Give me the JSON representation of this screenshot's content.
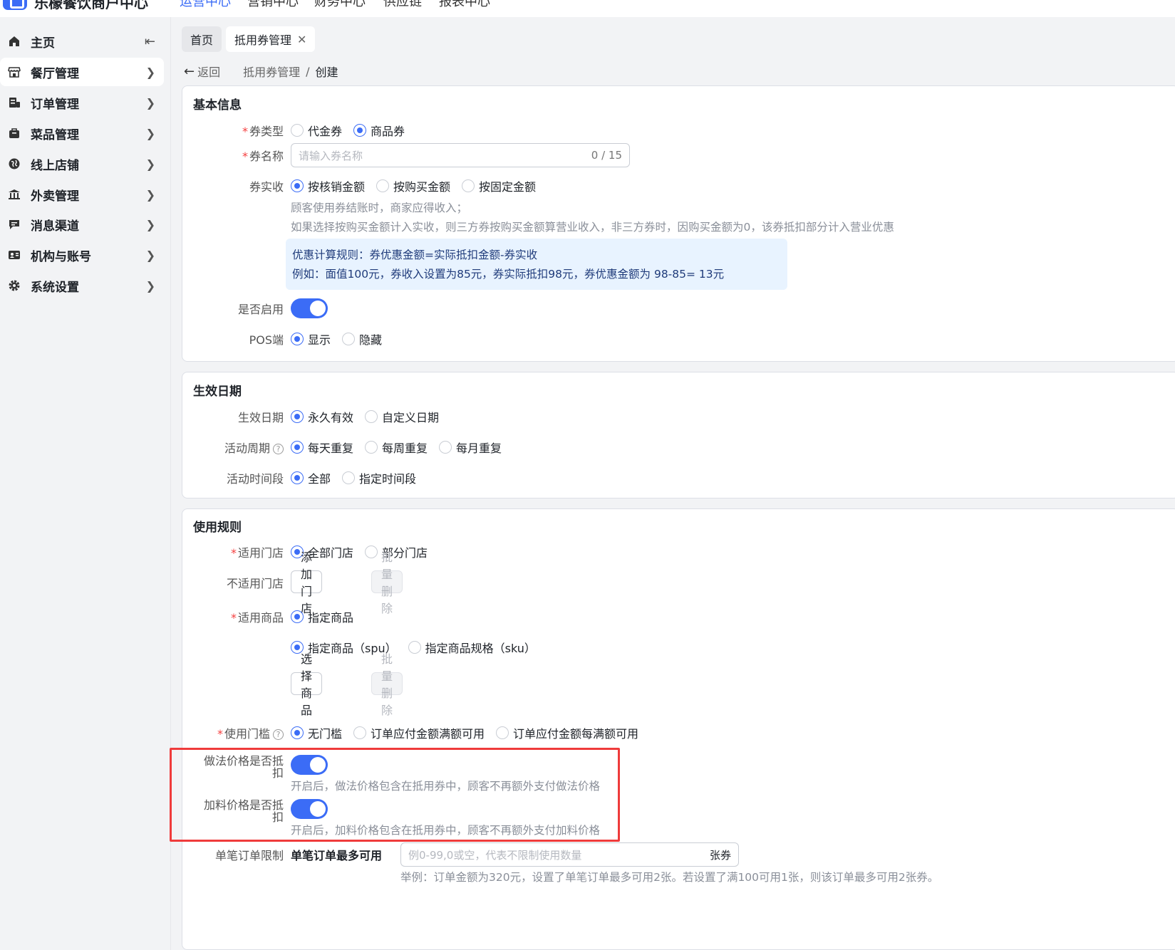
{
  "topnav": {
    "app_title": "乐檬餐饮商户中心",
    "items": [
      "运营中心",
      "营销中心",
      "财务中心",
      "供应链",
      "报表中心"
    ]
  },
  "sidebar": {
    "collapse_icon": "collapse-left-icon",
    "items": [
      {
        "label": "主页",
        "icon": "home-icon"
      },
      {
        "label": "餐厅管理",
        "icon": "store-icon"
      },
      {
        "label": "订单管理",
        "icon": "order-icon"
      },
      {
        "label": "菜品管理",
        "icon": "dish-icon"
      },
      {
        "label": "线上店铺",
        "icon": "globe-icon"
      },
      {
        "label": "外卖管理",
        "icon": "bank-icon"
      },
      {
        "label": "消息渠道",
        "icon": "message-icon"
      },
      {
        "label": "机构与账号",
        "icon": "account-icon"
      },
      {
        "label": "系统设置",
        "icon": "gear-icon"
      }
    ]
  },
  "tabs": [
    {
      "label": "首页"
    },
    {
      "label": "抵用券管理"
    }
  ],
  "back_label": "返回",
  "breadcrumb": {
    "parent": "抵用券管理",
    "sep": "/",
    "current": "创建"
  },
  "basic": {
    "title": "基本信息",
    "type_label": "券类型",
    "type_options": [
      "代金券",
      "商品券"
    ],
    "name_label": "券名称",
    "name_placeholder": "请输入券名称",
    "name_counter": "0 / 15",
    "income_label": "券实收",
    "income_options": [
      "按核销金额",
      "按购买金额",
      "按固定金额"
    ],
    "income_hint1": "顾客使用券结账时，商家应得收入；",
    "income_hint2": "如果选择按购买金额计入实收，则三方券按购买金额算营业收入，非三方券时，因购买金额为0，该券抵扣部分计入营业优惠",
    "info_line1": "优惠计算规则：券优惠金额=实际抵扣金额-券实收",
    "info_line2": "例如：面值100元，券收入设置为85元，券实际抵扣98元，券优惠金额为 98-85= 13元",
    "enable_label": "是否启用",
    "pos_label": "POS端",
    "pos_options": [
      "显示",
      "隐藏"
    ]
  },
  "validity": {
    "title": "生效日期",
    "date_label": "生效日期",
    "date_options": [
      "永久有效",
      "自定义日期"
    ],
    "cycle_label": "活动周期",
    "cycle_options": [
      "每天重复",
      "每周重复",
      "每月重复"
    ],
    "period_label": "活动时间段",
    "period_options": [
      "全部",
      "指定时间段"
    ]
  },
  "rules": {
    "title": "使用规则",
    "store_label": "适用门店",
    "store_options": [
      "全部门店",
      "部分门店"
    ],
    "exclude_label": "不适用门店",
    "add_store_btn": "添加门店",
    "batch_delete_btn": "批量删除",
    "goods_label": "适用商品",
    "goods_option": "指定商品",
    "goods_sub_options": [
      "指定商品（spu）",
      "指定商品规格（sku）"
    ],
    "select_goods_btn": "选择商品",
    "threshold_label": "使用门槛",
    "threshold_options": [
      "无门槛",
      "订单应付金额满额可用",
      "订单应付金额每满额可用"
    ],
    "method_label_1": "做法价格是否抵",
    "method_label_2": "扣",
    "method_hint": "开启后，做法价格包含在抵用券中，顾客不再额外支付做法价格",
    "addon_label_1": "加料价格是否抵",
    "addon_label_2": "扣",
    "addon_hint": "开启后，加料价格包含在抵用券中，顾客不再额外支付加料价格",
    "limit_label": "单笔订单限制",
    "limit_prefix": "单笔订单最多可用",
    "limit_placeholder": "例0-99,0或空，代表不限制使用数量",
    "limit_unit": "张券",
    "limit_hint": "举例：订单金额为320元，设置了单笔订单最多可用2张。若设置了满100可用1张，则该订单最多可用2张券。"
  },
  "colors": {
    "accent": "#3b6cf6",
    "highlight_box": "#ef3b3b"
  }
}
